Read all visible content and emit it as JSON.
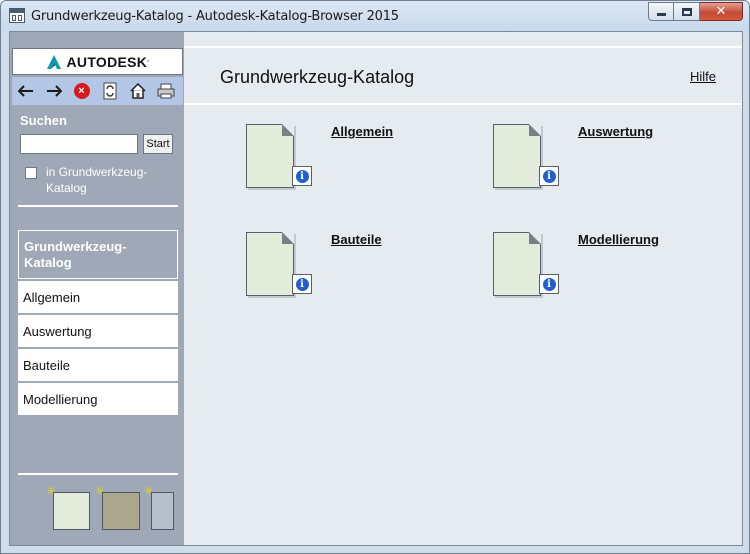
{
  "window": {
    "title": "Grundwerkzeug-Katalog - Autodesk-Katalog-Browser 2015",
    "minimize_glyph": "",
    "maximize_glyph": "",
    "close_glyph": "✕"
  },
  "sidebar": {
    "logo_text": "AUTODESK",
    "logo_mark": ".",
    "nav_icons": [
      "back-arrow-icon",
      "forward-arrow-icon",
      "stop-icon",
      "refresh-icon",
      "home-icon",
      "print-icon"
    ],
    "search": {
      "label": "Suchen",
      "value": "",
      "placeholder": "",
      "start_label": "Start",
      "scope_label": "in Grundwerkzeug-Katalog"
    },
    "selected": "Grundwerkzeug-Katalog",
    "items": [
      {
        "label": "Allgemein"
      },
      {
        "label": "Auswertung"
      },
      {
        "label": "Bauteile"
      },
      {
        "label": "Modellierung"
      }
    ],
    "bottom_icons": [
      "new-document-icon",
      "new-catalog-icon",
      "new-panel-icon"
    ]
  },
  "main": {
    "title": "Grundwerkzeug-Katalog",
    "help": "Hilfe",
    "tiles": [
      {
        "label": "Allgemein"
      },
      {
        "label": "Auswertung"
      },
      {
        "label": "Bauteile"
      },
      {
        "label": "Modellierung"
      }
    ]
  },
  "colors": {
    "sidebar_bg": "#9ea8b6",
    "main_bg": "#e6ebf0",
    "doc_fill": "#e3ecda",
    "info_blue": "#1f5fd0",
    "stop_red": "#d71920",
    "autodesk_teal": "#0a9bb0"
  }
}
